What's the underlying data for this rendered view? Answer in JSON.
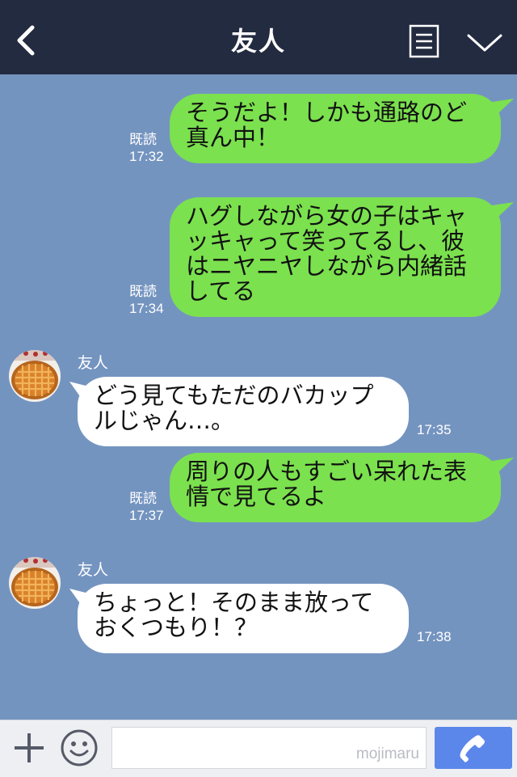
{
  "header": {
    "title": "友人"
  },
  "messages": [
    {
      "dir": "out",
      "text": "そうだよ！しかも通路のど\n真ん中！",
      "read": "既読",
      "time": "17:32"
    },
    {
      "dir": "out",
      "text": "ハグしながら女の子はキャ\nッキャって笑ってるし、彼\nはニヤニヤしながら内緒話\nしてる",
      "read": "既読",
      "time": "17:34"
    },
    {
      "dir": "in",
      "sender": "友人",
      "text": "どう見てもただのバカップ\nルじゃん…。",
      "time": "17:35"
    },
    {
      "dir": "out",
      "text": "周りの人もすごい呆れた表\n情で見てるよ",
      "read": "既読",
      "time": "17:37"
    },
    {
      "dir": "in",
      "sender": "友人",
      "text": "ちょっと！そのまま放って\nおくつもり！？",
      "time": "17:38"
    }
  ],
  "bottom": {
    "input_value": "",
    "watermark": "mojimaru"
  },
  "colors": {
    "header_bg": "#232b40",
    "chat_bg": "#7494c0",
    "outgoing_bubble": "#7be14e",
    "incoming_bubble": "#ffffff",
    "send_button": "#5b87ea"
  },
  "icons": {
    "back": "chevron-left-icon",
    "menu": "note-list-icon",
    "collapse": "chevron-down-icon",
    "plus": "plus-icon",
    "emoji": "smiley-icon",
    "call": "phone-icon",
    "avatar": "pie-avatar"
  }
}
